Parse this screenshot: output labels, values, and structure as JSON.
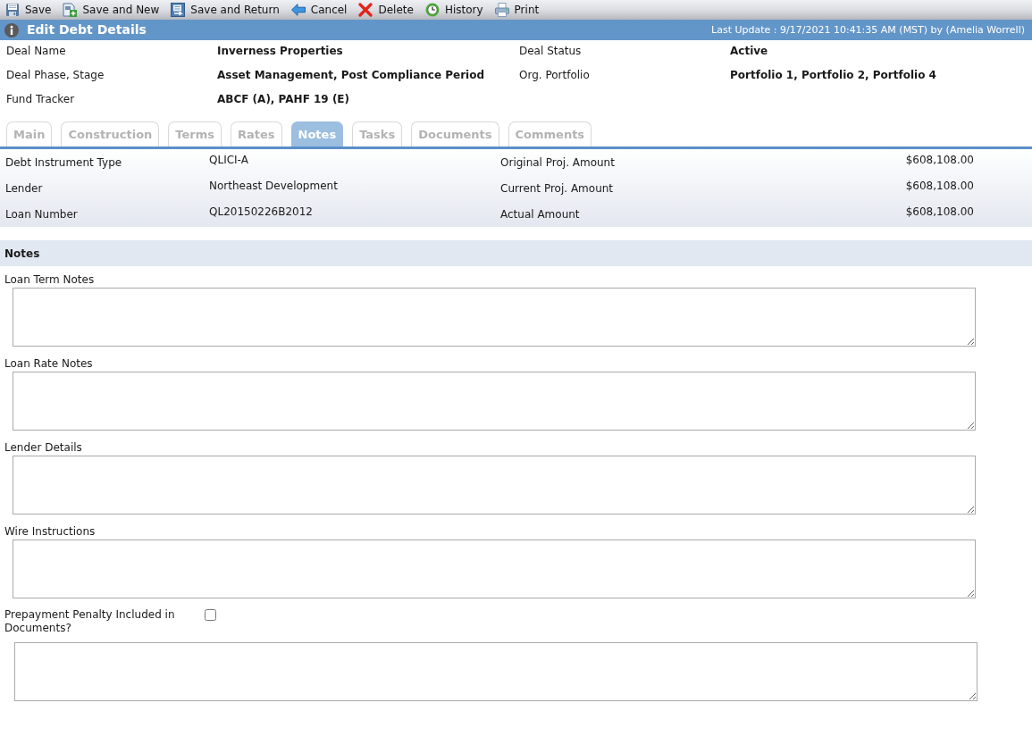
{
  "toolbar": {
    "buttons": [
      {
        "kind": "save",
        "label": "Save"
      },
      {
        "kind": "save_new",
        "label": "Save and New"
      },
      {
        "kind": "save_return",
        "label": "Save and Return"
      },
      {
        "kind": "cancel",
        "label": "Cancel"
      },
      {
        "kind": "delete",
        "label": "Delete"
      },
      {
        "kind": "history",
        "label": "History"
      },
      {
        "kind": "print",
        "label": "Print"
      }
    ]
  },
  "header": {
    "title": "Edit Debt Details",
    "last_update": "Last Update : 9/17/2021 10:41:35 AM (MST) by (Amelia Worrell)"
  },
  "deal_info": {
    "rows": [
      {
        "fields": [
          {
            "label": "Deal Name",
            "value": "Inverness Properties"
          },
          {
            "label": "Deal Status",
            "value": "Active"
          }
        ]
      },
      {
        "fields": [
          {
            "label": "Deal Phase, Stage",
            "value": "Asset Management, Post Compliance Period"
          },
          {
            "label": "Org. Portfolio",
            "value": "Portfolio 1, Portfolio 2, Portfolio 4"
          }
        ]
      },
      {
        "fields": [
          {
            "label": "Fund Tracker",
            "value": "ABCF (A), PAHF 19 (E)"
          }
        ]
      }
    ]
  },
  "tabs": [
    {
      "label": "Main",
      "selected": false
    },
    {
      "label": "Construction",
      "selected": false
    },
    {
      "label": "Terms",
      "selected": false
    },
    {
      "label": "Rates",
      "selected": false
    },
    {
      "label": "Notes",
      "selected": true
    },
    {
      "label": "Tasks",
      "selected": false
    },
    {
      "label": "Documents",
      "selected": false
    },
    {
      "label": "Comments",
      "selected": false
    }
  ],
  "summary": {
    "rows": [
      {
        "fields": [
          {
            "label": "Debt Instrument Type",
            "value": "QLICI-A"
          },
          {
            "label": "Original Proj. Amount",
            "value": "$608,108.00"
          }
        ]
      },
      {
        "fields": [
          {
            "label": "Lender",
            "value": "Northeast Development"
          },
          {
            "label": "Current Proj. Amount",
            "value": "$608,108.00"
          }
        ]
      },
      {
        "fields": [
          {
            "label": "Loan Number",
            "value": "QL20150226B2012"
          },
          {
            "label": "Actual Amount",
            "value": "$608,108.00"
          }
        ]
      }
    ]
  },
  "notes": {
    "title": "Notes",
    "fields": [
      {
        "kind": "textarea",
        "label": "Loan Term Notes"
      },
      {
        "kind": "textarea",
        "label": "Loan Rate Notes"
      },
      {
        "kind": "textarea",
        "label": "Lender Details"
      },
      {
        "kind": "textarea",
        "label": "Wire Instructions"
      },
      {
        "kind": "checkbox",
        "label": "Prepayment Penalty Included in Documents?",
        "checked": false
      }
    ]
  }
}
